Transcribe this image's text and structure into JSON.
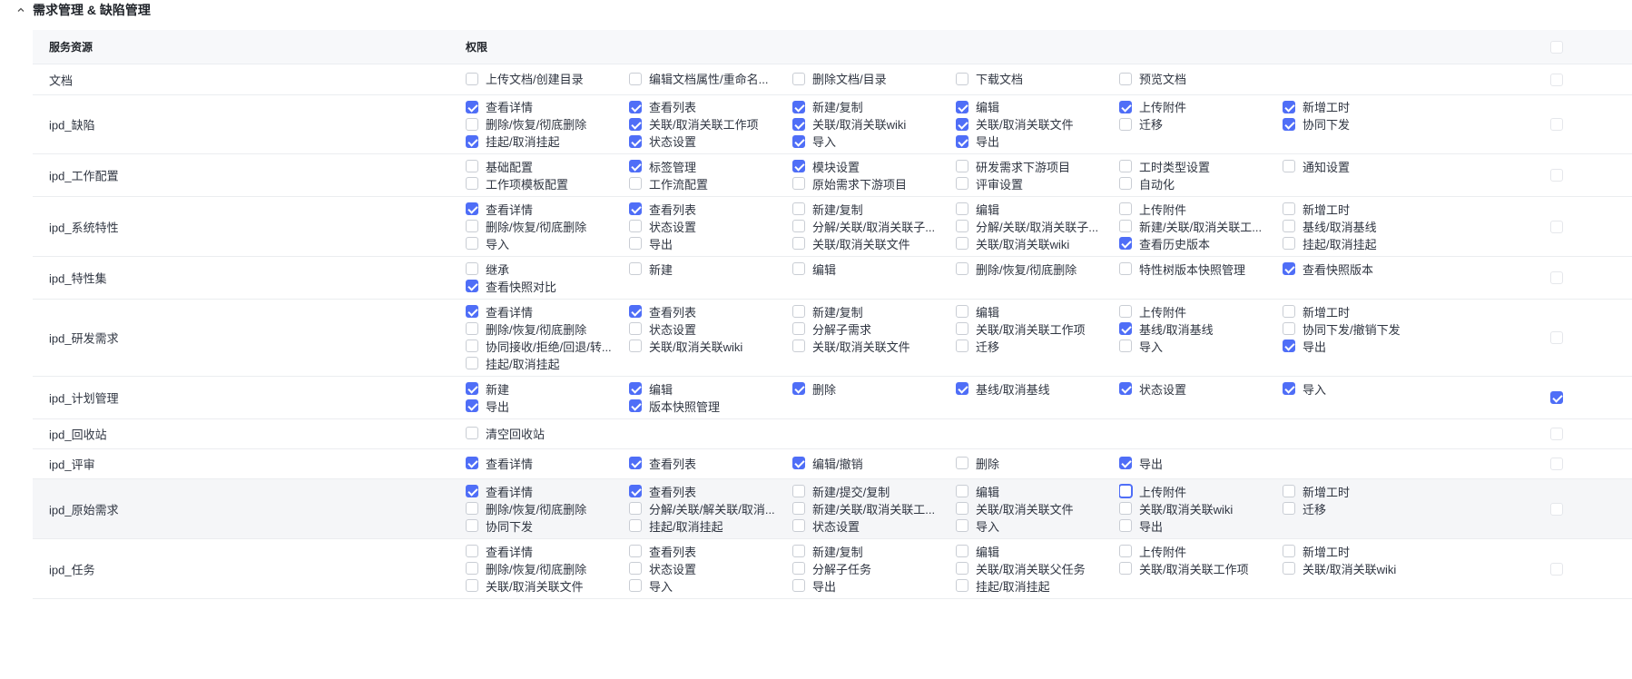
{
  "section": {
    "title": "需求管理 & 缺陷管理",
    "icon": "chevron-up-icon"
  },
  "header": {
    "resource_col": "服务资源",
    "permission_col": "权限",
    "select_all_checked": false
  },
  "colors": {
    "accent": "#4f6ef7",
    "border": "#c9cdd4",
    "header_bg": "#f7f8fa"
  },
  "rows": [
    {
      "name": "文档",
      "row_checked": false,
      "height": 34,
      "perms": [
        {
          "label": "上传文档/创建目录",
          "checked": false
        },
        {
          "label": "编辑文档属性/重命名...",
          "checked": false
        },
        {
          "label": "删除文档/目录",
          "checked": false
        },
        {
          "label": "下载文档",
          "checked": false
        },
        {
          "label": "预览文档",
          "checked": false
        }
      ]
    },
    {
      "name": "ipd_缺陷",
      "row_checked": false,
      "height": 65,
      "perms": [
        {
          "label": "查看详情",
          "checked": true
        },
        {
          "label": "查看列表",
          "checked": true
        },
        {
          "label": "新建/复制",
          "checked": true
        },
        {
          "label": "编辑",
          "checked": true
        },
        {
          "label": "上传附件",
          "checked": true
        },
        {
          "label": "新增工时",
          "checked": true
        },
        {
          "label": "删除/恢复/彻底删除",
          "checked": false
        },
        {
          "label": "关联/取消关联工作项",
          "checked": true
        },
        {
          "label": "关联/取消关联wiki",
          "checked": true
        },
        {
          "label": "关联/取消关联文件",
          "checked": true
        },
        {
          "label": "迁移",
          "checked": false
        },
        {
          "label": "协同下发",
          "checked": true
        },
        {
          "label": "挂起/取消挂起",
          "checked": true
        },
        {
          "label": "状态设置",
          "checked": true
        },
        {
          "label": "导入",
          "checked": true
        },
        {
          "label": "导出",
          "checked": true
        }
      ]
    },
    {
      "name": "ipd_工作配置",
      "row_checked": false,
      "height": 47,
      "perms": [
        {
          "label": "基础配置",
          "checked": false
        },
        {
          "label": "标签管理",
          "checked": true
        },
        {
          "label": "模块设置",
          "checked": true
        },
        {
          "label": "研发需求下游项目",
          "checked": false
        },
        {
          "label": "工时类型设置",
          "checked": false
        },
        {
          "label": "通知设置",
          "checked": false
        },
        {
          "label": "工作项模板配置",
          "checked": false
        },
        {
          "label": "工作流配置",
          "checked": false
        },
        {
          "label": "原始需求下游项目",
          "checked": false
        },
        {
          "label": "评审设置",
          "checked": false
        },
        {
          "label": "自动化",
          "checked": false
        }
      ]
    },
    {
      "name": "ipd_系统特性",
      "row_checked": false,
      "height": 66,
      "perms": [
        {
          "label": "查看详情",
          "checked": true
        },
        {
          "label": "查看列表",
          "checked": true
        },
        {
          "label": "新建/复制",
          "checked": false
        },
        {
          "label": "编辑",
          "checked": false
        },
        {
          "label": "上传附件",
          "checked": false
        },
        {
          "label": "新增工时",
          "checked": false
        },
        {
          "label": "删除/恢复/彻底删除",
          "checked": false
        },
        {
          "label": "状态设置",
          "checked": false
        },
        {
          "label": "分解/关联/取消关联子...",
          "checked": false
        },
        {
          "label": "分解/关联/取消关联子...",
          "checked": false
        },
        {
          "label": "新建/关联/取消关联工...",
          "checked": false
        },
        {
          "label": "基线/取消基线",
          "checked": false
        },
        {
          "label": "导入",
          "checked": false
        },
        {
          "label": "导出",
          "checked": false
        },
        {
          "label": "关联/取消关联文件",
          "checked": false
        },
        {
          "label": "关联/取消关联wiki",
          "checked": false
        },
        {
          "label": "查看历史版本",
          "checked": true
        },
        {
          "label": "挂起/取消挂起",
          "checked": false
        }
      ]
    },
    {
      "name": "ipd_特性集",
      "row_checked": false,
      "height": 47,
      "perms": [
        {
          "label": "继承",
          "checked": false
        },
        {
          "label": "新建",
          "checked": false
        },
        {
          "label": "编辑",
          "checked": false
        },
        {
          "label": "删除/恢复/彻底删除",
          "checked": false
        },
        {
          "label": "特性树版本快照管理",
          "checked": false
        },
        {
          "label": "查看快照版本",
          "checked": true
        },
        {
          "label": "查看快照对比",
          "checked": true
        }
      ]
    },
    {
      "name": "ipd_研发需求",
      "row_checked": false,
      "height": 85,
      "perms": [
        {
          "label": "查看详情",
          "checked": true
        },
        {
          "label": "查看列表",
          "checked": true
        },
        {
          "label": "新建/复制",
          "checked": false
        },
        {
          "label": "编辑",
          "checked": false
        },
        {
          "label": "上传附件",
          "checked": false
        },
        {
          "label": "新增工时",
          "checked": false
        },
        {
          "label": "删除/恢复/彻底删除",
          "checked": false
        },
        {
          "label": "状态设置",
          "checked": false
        },
        {
          "label": "分解子需求",
          "checked": false
        },
        {
          "label": "关联/取消关联工作项",
          "checked": false
        },
        {
          "label": "基线/取消基线",
          "checked": true
        },
        {
          "label": "协同下发/撤销下发",
          "checked": false
        },
        {
          "label": "协同接收/拒绝/回退/转...",
          "checked": false
        },
        {
          "label": "关联/取消关联wiki",
          "checked": false
        },
        {
          "label": "关联/取消关联文件",
          "checked": false
        },
        {
          "label": "迁移",
          "checked": false
        },
        {
          "label": "导入",
          "checked": false
        },
        {
          "label": "导出",
          "checked": true
        },
        {
          "label": "挂起/取消挂起",
          "checked": false
        }
      ]
    },
    {
      "name": "ipd_计划管理",
      "row_checked": true,
      "height": 47,
      "perms": [
        {
          "label": "新建",
          "checked": true
        },
        {
          "label": "编辑",
          "checked": true
        },
        {
          "label": "删除",
          "checked": true
        },
        {
          "label": "基线/取消基线",
          "checked": true
        },
        {
          "label": "状态设置",
          "checked": true
        },
        {
          "label": "导入",
          "checked": true
        },
        {
          "label": "导出",
          "checked": true
        },
        {
          "label": "版本快照管理",
          "checked": true
        }
      ]
    },
    {
      "name": "ipd_回收站",
      "row_checked": false,
      "height": 33,
      "perms": [
        {
          "label": "清空回收站",
          "checked": false
        }
      ]
    },
    {
      "name": "ipd_评审",
      "row_checked": false,
      "height": 33,
      "perms": [
        {
          "label": "查看详情",
          "checked": true
        },
        {
          "label": "查看列表",
          "checked": true
        },
        {
          "label": "编辑/撤销",
          "checked": true
        },
        {
          "label": "删除",
          "checked": false
        },
        {
          "label": "导出",
          "checked": true
        }
      ]
    },
    {
      "name": "ipd_原始需求",
      "row_checked": false,
      "height": 66,
      "highlight": true,
      "perms": [
        {
          "label": "查看详情",
          "checked": true
        },
        {
          "label": "查看列表",
          "checked": true
        },
        {
          "label": "新建/提交/复制",
          "checked": false
        },
        {
          "label": "编辑",
          "checked": false
        },
        {
          "label": "上传附件",
          "checked": false,
          "focus": true
        },
        {
          "label": "新增工时",
          "checked": false
        },
        {
          "label": "删除/恢复/彻底删除",
          "checked": false
        },
        {
          "label": "分解/关联/解关联/取消...",
          "checked": false
        },
        {
          "label": "新建/关联/取消关联工...",
          "checked": false
        },
        {
          "label": "关联/取消关联文件",
          "checked": false
        },
        {
          "label": "关联/取消关联wiki",
          "checked": false
        },
        {
          "label": "迁移",
          "checked": false
        },
        {
          "label": "协同下发",
          "checked": false
        },
        {
          "label": "挂起/取消挂起",
          "checked": false
        },
        {
          "label": "状态设置",
          "checked": false
        },
        {
          "label": "导入",
          "checked": false
        },
        {
          "label": "导出",
          "checked": false
        }
      ]
    },
    {
      "name": "ipd_任务",
      "row_checked": false,
      "height": 66,
      "perms": [
        {
          "label": "查看详情",
          "checked": false
        },
        {
          "label": "查看列表",
          "checked": false
        },
        {
          "label": "新建/复制",
          "checked": false
        },
        {
          "label": "编辑",
          "checked": false
        },
        {
          "label": "上传附件",
          "checked": false
        },
        {
          "label": "新增工时",
          "checked": false
        },
        {
          "label": "删除/恢复/彻底删除",
          "checked": false
        },
        {
          "label": "状态设置",
          "checked": false
        },
        {
          "label": "分解子任务",
          "checked": false
        },
        {
          "label": "关联/取消关联父任务",
          "checked": false
        },
        {
          "label": "关联/取消关联工作项",
          "checked": false
        },
        {
          "label": "关联/取消关联wiki",
          "checked": false
        },
        {
          "label": "关联/取消关联文件",
          "checked": false
        },
        {
          "label": "导入",
          "checked": false
        },
        {
          "label": "导出",
          "checked": false
        },
        {
          "label": "挂起/取消挂起",
          "checked": false
        }
      ]
    }
  ]
}
